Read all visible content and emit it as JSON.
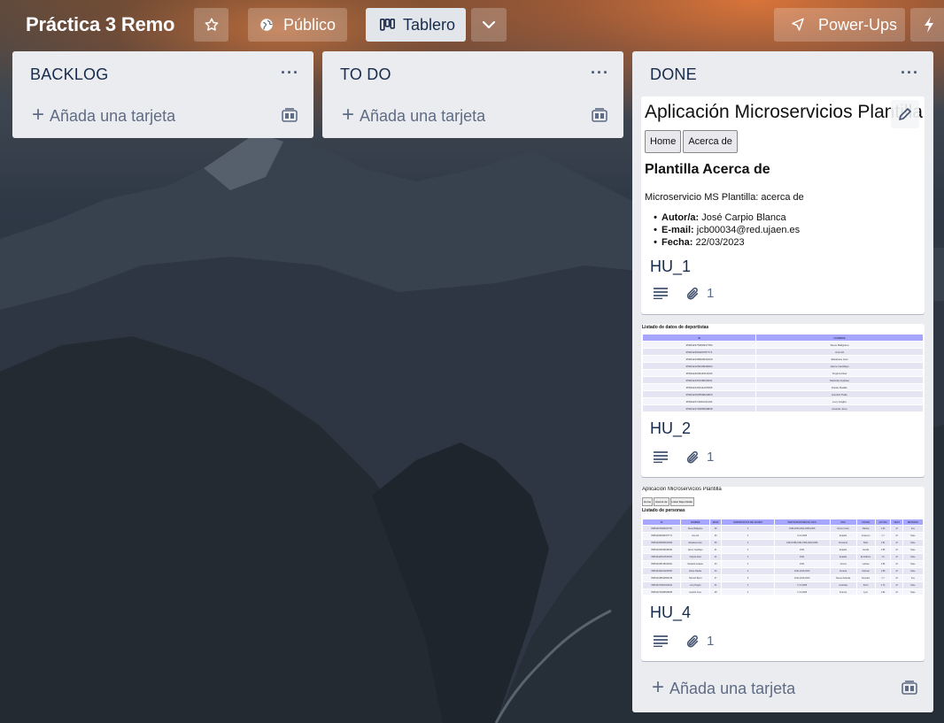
{
  "header": {
    "board_title": "Práctica 3 Remo",
    "visibility_label": "Público",
    "view_label": "Tablero",
    "powerups_label": "Power-Ups"
  },
  "lists": [
    {
      "title": "BACKLOG",
      "menu": "···",
      "add_card_label": "Añada una tarjeta"
    },
    {
      "title": "TO DO",
      "menu": "···",
      "add_card_label": "Añada una tarjeta"
    },
    {
      "title": "DONE",
      "menu": "···",
      "add_card_label": "Añada una tarjeta"
    }
  ],
  "cards": [
    {
      "title": "HU_1",
      "attachments": "1",
      "cover": {
        "heading": "Aplicación Microservicios Plantilla",
        "nav": [
          "Home",
          "Acerca de"
        ],
        "subheading": "Plantilla Acerca de",
        "description": "Microservicio MS Plantilla: acerca de",
        "details": [
          {
            "label": "Autor/a:",
            "value": "José Carpio Blanca"
          },
          {
            "label": "E-mail:",
            "value": "jcb00034@red.ujaen.es"
          },
          {
            "label": "Fecha:",
            "value": "22/03/2023"
          }
        ]
      }
    },
    {
      "title": "HU_2",
      "attachments": "1",
      "cover": {
        "heading": "Listado de datos de deportistas",
        "columns": [
          "ID",
          "NOMBRE"
        ],
        "rows": [
          [
            "359642375482947784",
            "Steve Ballgrace"
          ],
          [
            "359642396489787771",
            "Ana Gil"
          ],
          [
            "359642408990631069",
            "Elisabeta Llan"
          ],
          [
            "359642425049948494",
            "Jaime Castillejo"
          ],
          [
            "359642429911515203",
            "Virginia Diaz"
          ],
          [
            "359642435148043001",
            "Stefania Gudaso"
          ],
          [
            "359642440211226365",
            "Dante Radde"
          ],
          [
            "359642452558622803",
            "Hamish Pallo"
          ],
          [
            "359642474001041164",
            "Lucy Hagbo"
          ],
          [
            "359642479485608838",
            "Guardo Jone"
          ]
        ]
      }
    },
    {
      "title": "HU_4",
      "attachments": "1",
      "cover": {
        "heading": "Aplicación Microservicios Plantilla",
        "nav": [
          "Home",
          "Acerca de",
          "Listar Deportistas"
        ],
        "subheading": "Listado de personas",
        "columns": [
          "ID",
          "NOMBRE",
          "EDAD",
          "CAMPEONATOS DEL MUNDO",
          "PARTICIPACIONES EN JJOO",
          "PAIS",
          "CIUDAD",
          "ALTURA",
          "SEXO",
          "RETIRADO"
        ],
        "rows": [
          [
            "359642375482947784",
            "Steve Ballgrace",
            "38",
            "3",
            "1996,2000,2004,2008,2008",
            "Reino Unido",
            "Marlow",
            "1.93",
            "M",
            "true"
          ],
          [
            "359642396489787771",
            "Ana Gil",
            "36",
            "3",
            "12-6-2008",
            "España",
            "Ampuero",
            "1.7",
            "M",
            "false"
          ],
          [
            "359642408990631069",
            "Elisabeta Llan",
            "56",
            "3",
            "1984,1988,1992,1996,2000,2008",
            "Rumanía",
            "Sibiu",
            "1.81",
            "M",
            "false"
          ],
          [
            "359642425049948494",
            "Jaime Castillejo",
            "21",
            "3",
            "2021",
            "España",
            "Sevilla",
            "1.85",
            "M",
            "false"
          ],
          [
            "359642429911515203",
            "Virginia Diaz",
            "21",
            "3",
            "2021",
            "España",
            "El Astillero",
            "1.6",
            "M",
            "false"
          ],
          [
            "359642435148043001",
            "Stefania Gudaso",
            "33",
            "3",
            "2021",
            "Grecia",
            "Larissa",
            "1.86",
            "M",
            "false"
          ],
          [
            "359642440211226365",
            "Dante Radde",
            "34",
            "2",
            "2021,2016,2020",
            "Croacia",
            "Vukovar",
            "1.88",
            "M",
            "false"
          ],
          [
            "359642448546890239",
            "Hamish Bond",
            "37",
            "6",
            "2012,2016,2020",
            "Nueva Zelanda",
            "Dunedin",
            "1.7",
            "M",
            "true"
          ],
          [
            "359642474001041164",
            "Lucy Hagbo",
            "31",
            "3",
            "17-6-2008",
            "Australia",
            "Perth",
            "1.74",
            "M",
            "false"
          ],
          [
            "359642479485608838",
            "Guardo Jone",
            "28",
            "2",
            "17-6-2008",
            "Francia",
            "Lyon",
            "1.82",
            "M",
            "false"
          ]
        ]
      }
    }
  ],
  "colors": {
    "list_bg": "#ebecf0",
    "text_primary": "#172b4d",
    "text_subtle": "#5e6c84",
    "table_header": "#a6a6ff"
  },
  "icons": [
    "star-icon",
    "globe-icon",
    "board-icon",
    "chevron-down-icon",
    "rocket-icon",
    "bolt-icon",
    "plus-icon",
    "template-icon",
    "description-icon",
    "paperclip-icon",
    "pencil-icon"
  ]
}
